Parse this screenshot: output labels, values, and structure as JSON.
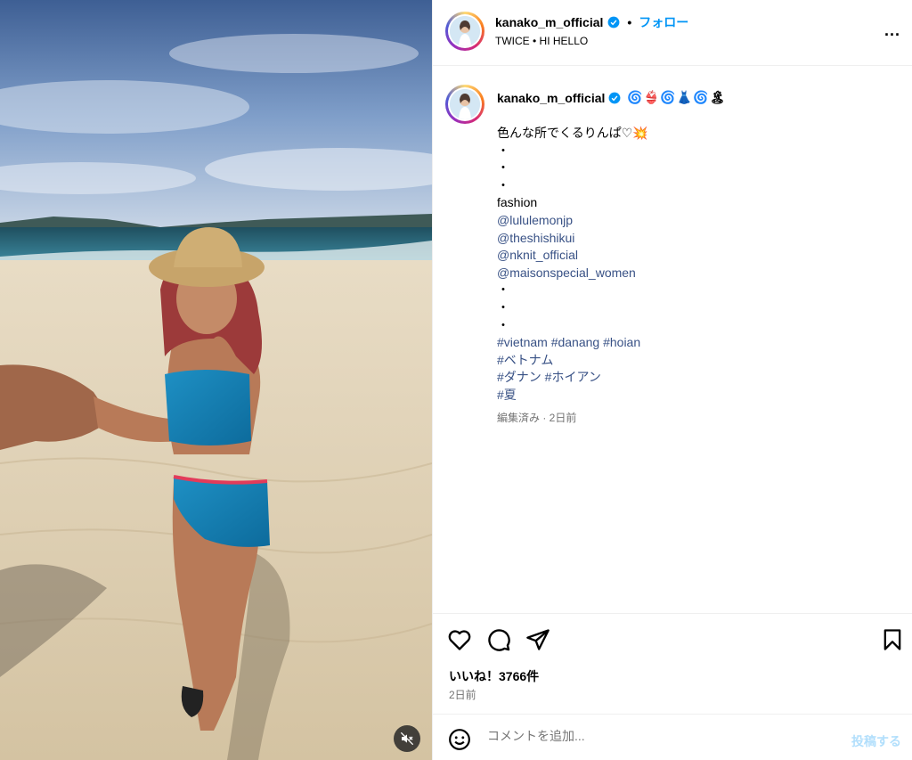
{
  "post": {
    "media_alt": "",
    "username": "kanako_m_official",
    "follow_label": "フォロー",
    "subtitle": "TWICE • HI HELLO",
    "more_label": "...",
    "caption": {
      "username": "kanako_m_official",
      "emoji_line": "🌀👙🌀👗🌀🏝",
      "line1": "色んな所でくるりんぱ♡",
      "line1_emoji": "💥",
      "dots1": [
        "・",
        "・",
        "・"
      ],
      "fashion_label": "fashion",
      "mentions": [
        "@lululemonjp",
        "@theshishikui",
        "@nknit_official",
        "@maisonspecial_women"
      ],
      "dots2": [
        "・",
        "・",
        "・"
      ],
      "hashtags_line1": "#vietnam #danang #hoian",
      "hashtags_line2": "#ベトナム",
      "hashtags_line3": "#ダナン #ホイアン",
      "hashtags_line4": "#夏",
      "meta": "編集済み · 2日前"
    },
    "likes": "いいね！3766件",
    "date": "2日前",
    "comment_placeholder": "コメントを追加...",
    "post_button": "投稿する"
  },
  "colors": {
    "link": "#385185",
    "follow": "#0095f6",
    "muted": "#737373",
    "post_disabled": "#b2dffc"
  }
}
